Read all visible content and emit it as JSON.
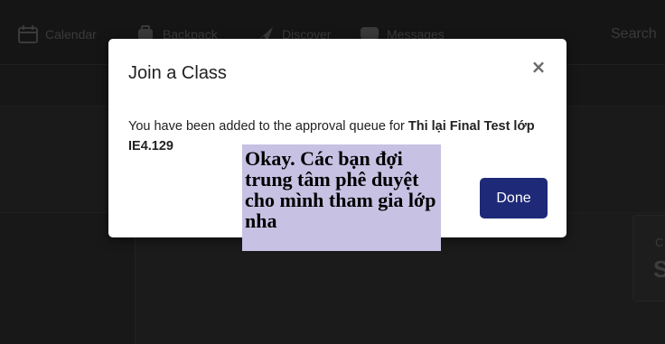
{
  "nav": {
    "items": [
      {
        "label": "Calendar",
        "icon": "calendar-icon"
      },
      {
        "label": "Backpack",
        "icon": "backpack-icon"
      },
      {
        "label": "Discover",
        "icon": "discover-icon"
      },
      {
        "label": "Messages",
        "icon": "messages-icon"
      }
    ],
    "search_label": "Search"
  },
  "side_panel": {
    "label": "C",
    "value": "S"
  },
  "modal": {
    "title": "Join a Class",
    "close_label": "×",
    "message_prefix": "You have been added to the approval queue for ",
    "class_name": "Thi lại Final Test lớp IE4.129",
    "done_label": "Done"
  },
  "caption": {
    "text": "Okay. Các bạn đợi trung tâm phê duyệt cho mình tham gia lớp nha"
  }
}
